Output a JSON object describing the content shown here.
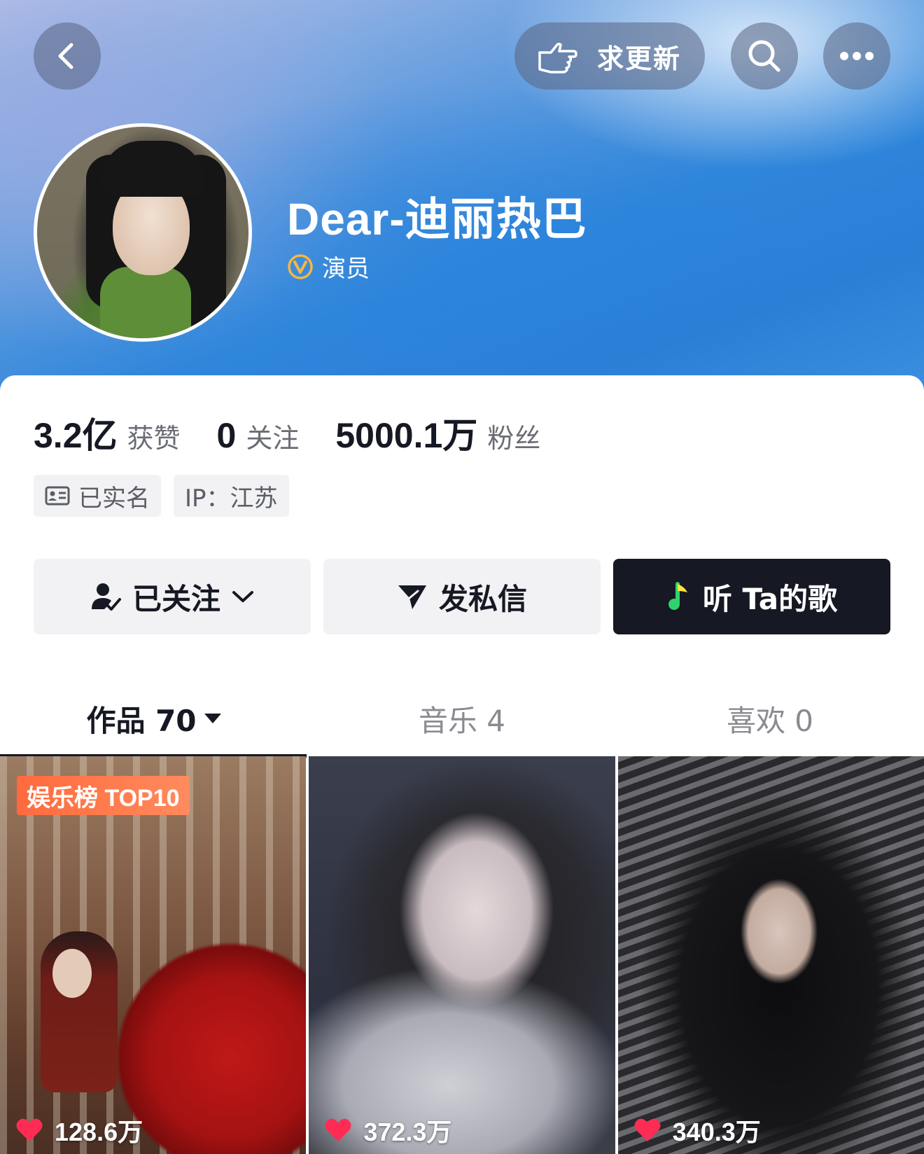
{
  "header": {
    "update_label": "求更新"
  },
  "profile": {
    "name": "Dear-迪丽热巴",
    "verify_label": "演员"
  },
  "stats": [
    {
      "value": "3.2亿",
      "label": "获赞"
    },
    {
      "value": "0",
      "label": "关注"
    },
    {
      "value": "5000.1万",
      "label": "粉丝"
    }
  ],
  "tags": {
    "realname": "已实名",
    "ip": "IP：江苏"
  },
  "actions": {
    "following": "已关注",
    "message": "发私信",
    "music": "听 Ta的歌"
  },
  "tabs": [
    {
      "label": "作品 70",
      "active": true
    },
    {
      "label": "音乐 4",
      "active": false
    },
    {
      "label": "喜欢 0",
      "active": false
    }
  ],
  "videos": [
    {
      "badge": "娱乐榜 TOP10",
      "likes": "128.6万"
    },
    {
      "likes": "372.3万"
    },
    {
      "likes": "340.3万"
    }
  ],
  "colors": {
    "like_heart": "#fe2c55",
    "badge_orange": "#ff6a3d",
    "dark_button": "#161823",
    "verify_gold": "#f5b83d"
  }
}
